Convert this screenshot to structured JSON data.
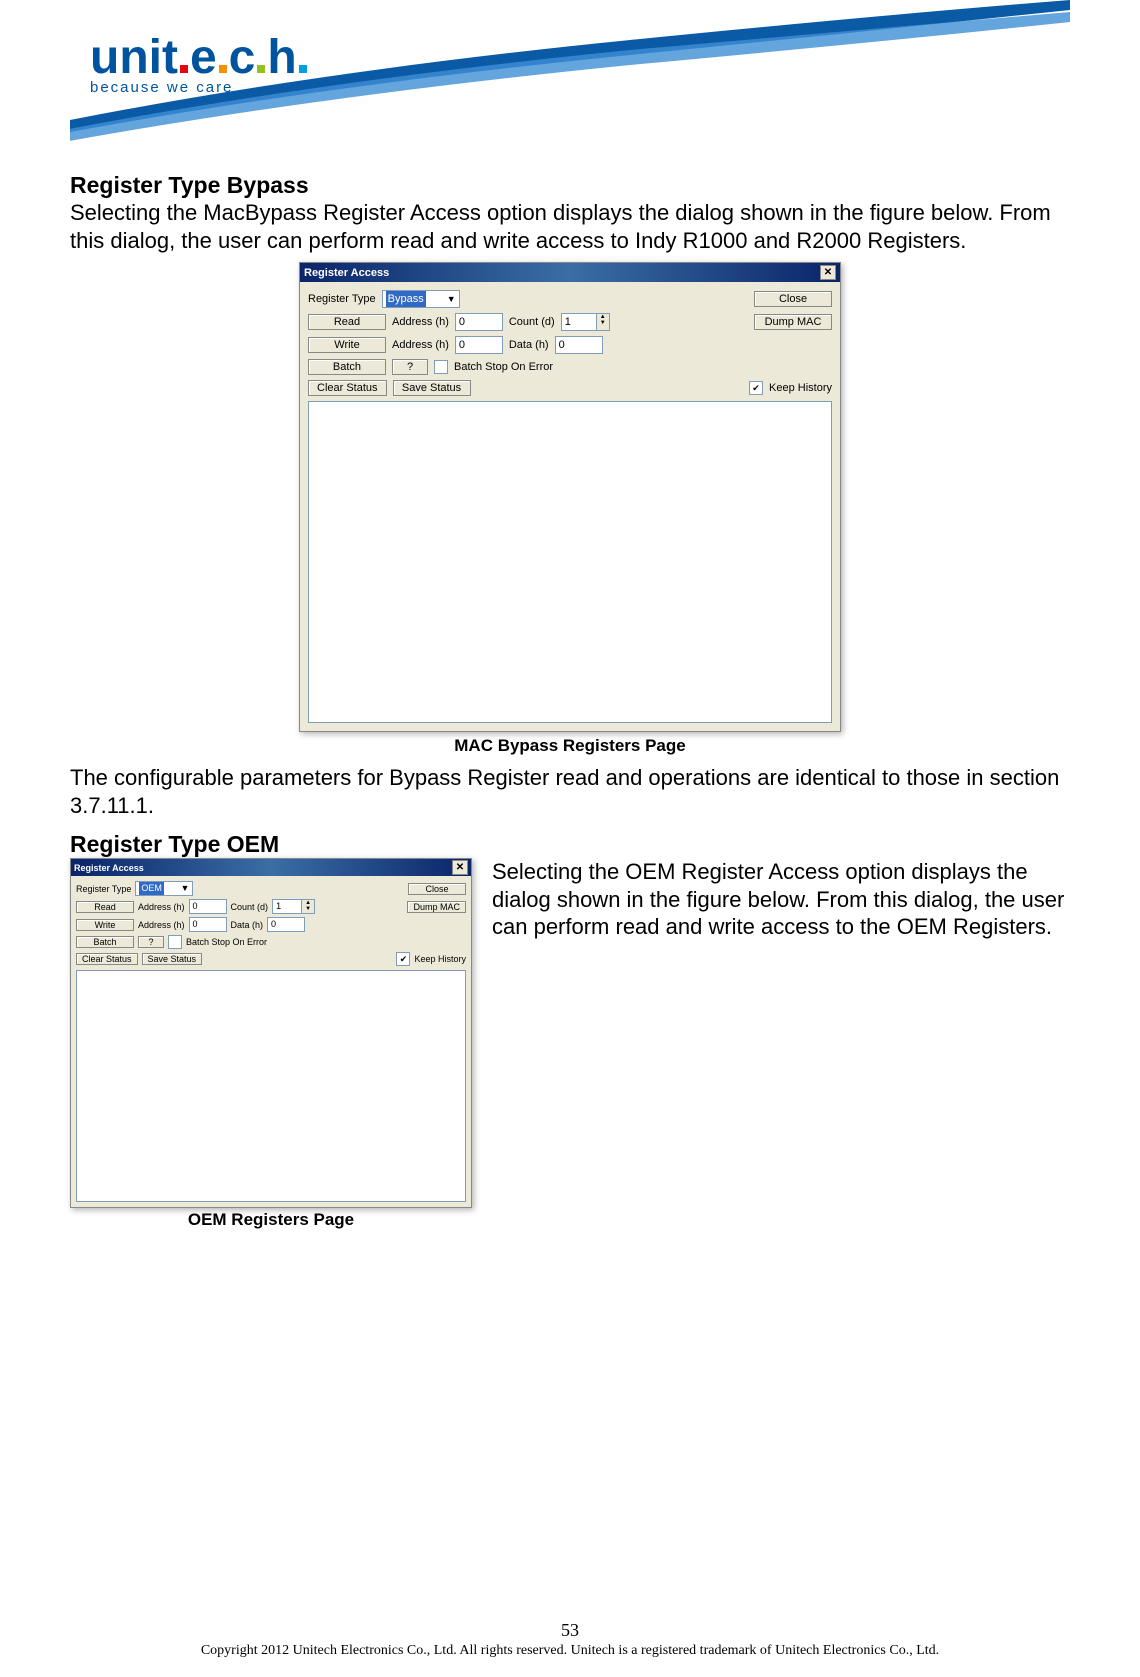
{
  "logo": {
    "name": "unitech",
    "tagline": "because we care"
  },
  "section1": {
    "heading": "Register Type Bypass",
    "para1": "Selecting the MacBypass Register Access option displays the dialog shown in the figure below. From this dialog, the user can perform read and write access to Indy R1000 and R2000 Registers.",
    "caption": "MAC Bypass Registers Page",
    "para2": "The configurable parameters for Bypass Register read and operations are identical to those in section 3.7.11.1."
  },
  "section2": {
    "heading": "Register Type OEM",
    "para": "Selecting the OEM Register Access option displays the dialog shown in the figure below. From this dialog, the user can perform read and write access to the OEM Registers.",
    "caption": "OEM Registers Page"
  },
  "dialog1": {
    "title": "Register Access",
    "register_type_label": "Register Type",
    "register_type_value": "Bypass",
    "close": "Close",
    "read": "Read",
    "write": "Write",
    "batch": "Batch",
    "q": "?",
    "address_label": "Address (h)",
    "address_value": "0",
    "count_label": "Count (d)",
    "count_value": "1",
    "data_label": "Data (h)",
    "data_value": "0",
    "dump_mac": "Dump MAC",
    "batch_stop": "Batch Stop On Error",
    "clear_status": "Clear Status",
    "save_status": "Save Status",
    "keep_history": "Keep History"
  },
  "dialog2": {
    "title": "Register Access",
    "register_type_label": "Register Type",
    "register_type_value": "OEM",
    "close": "Close",
    "read": "Read",
    "write": "Write",
    "batch": "Batch",
    "q": "?",
    "address_label": "Address (h)",
    "address_value": "0",
    "count_label": "Count (d)",
    "count_value": "1",
    "data_label": "Data (h)",
    "data_value": "0",
    "dump_mac": "Dump MAC",
    "batch_stop": "Batch Stop On Error",
    "clear_status": "Clear Status",
    "save_status": "Save Status",
    "keep_history": "Keep History"
  },
  "footer": {
    "page": "53",
    "copyright": "Copyright 2012 Unitech Electronics Co., Ltd. All rights reserved. Unitech is a registered trademark of Unitech Electronics Co., Ltd."
  }
}
